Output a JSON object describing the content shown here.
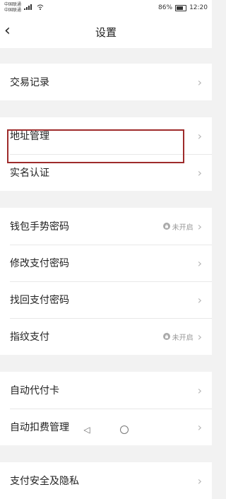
{
  "status_bar": {
    "carrier1": "中国联通",
    "carrier2": "中国联通",
    "battery": "86%",
    "time": "12:20"
  },
  "header": {
    "title": "设置",
    "back_icon": "chevron-left-icon"
  },
  "groups": [
    {
      "items": [
        {
          "label": "交易记录"
        }
      ]
    },
    {
      "items": [
        {
          "label": "地址管理"
        },
        {
          "label": "实名认证"
        }
      ]
    },
    {
      "items": [
        {
          "label": "钱包手势密码",
          "status": "未开启"
        },
        {
          "label": "修改支付密码"
        },
        {
          "label": "找回支付密码"
        },
        {
          "label": "指纹支付",
          "status": "未开启"
        }
      ]
    },
    {
      "items": [
        {
          "label": "自动代付卡"
        },
        {
          "label": "自动扣费管理"
        }
      ]
    },
    {
      "items": [
        {
          "label": "支付安全及隐私"
        }
      ]
    }
  ],
  "chevron": "›",
  "colors": {
    "highlight": "#9e2b2b",
    "background": "#f2f2f2"
  }
}
